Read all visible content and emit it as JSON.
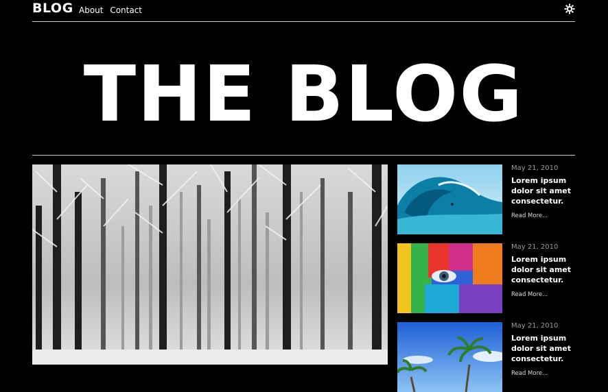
{
  "nav": {
    "logo": "BLOG",
    "links": [
      "About",
      "Contact"
    ],
    "theme_icon": "sun-gear-icon"
  },
  "hero": {
    "title": "THE BLOG"
  },
  "featured": {
    "image": "snowy-forest"
  },
  "posts": [
    {
      "date": "May 21, 2010",
      "title": "Lorem ipsum dolor sit amet consectetur.",
      "read_more": "Read More...",
      "image": "surfer-wave"
    },
    {
      "date": "May 21, 2010",
      "title": "Lorem ipsum dolor sit amet consectetur.",
      "read_more": "Read More...",
      "image": "rainbow-paint-face"
    },
    {
      "date": "May 21, 2010",
      "title": "Lorem ipsum dolor sit amet consectetur.",
      "read_more": "Read More...",
      "image": "palm-trees-sky"
    }
  ]
}
